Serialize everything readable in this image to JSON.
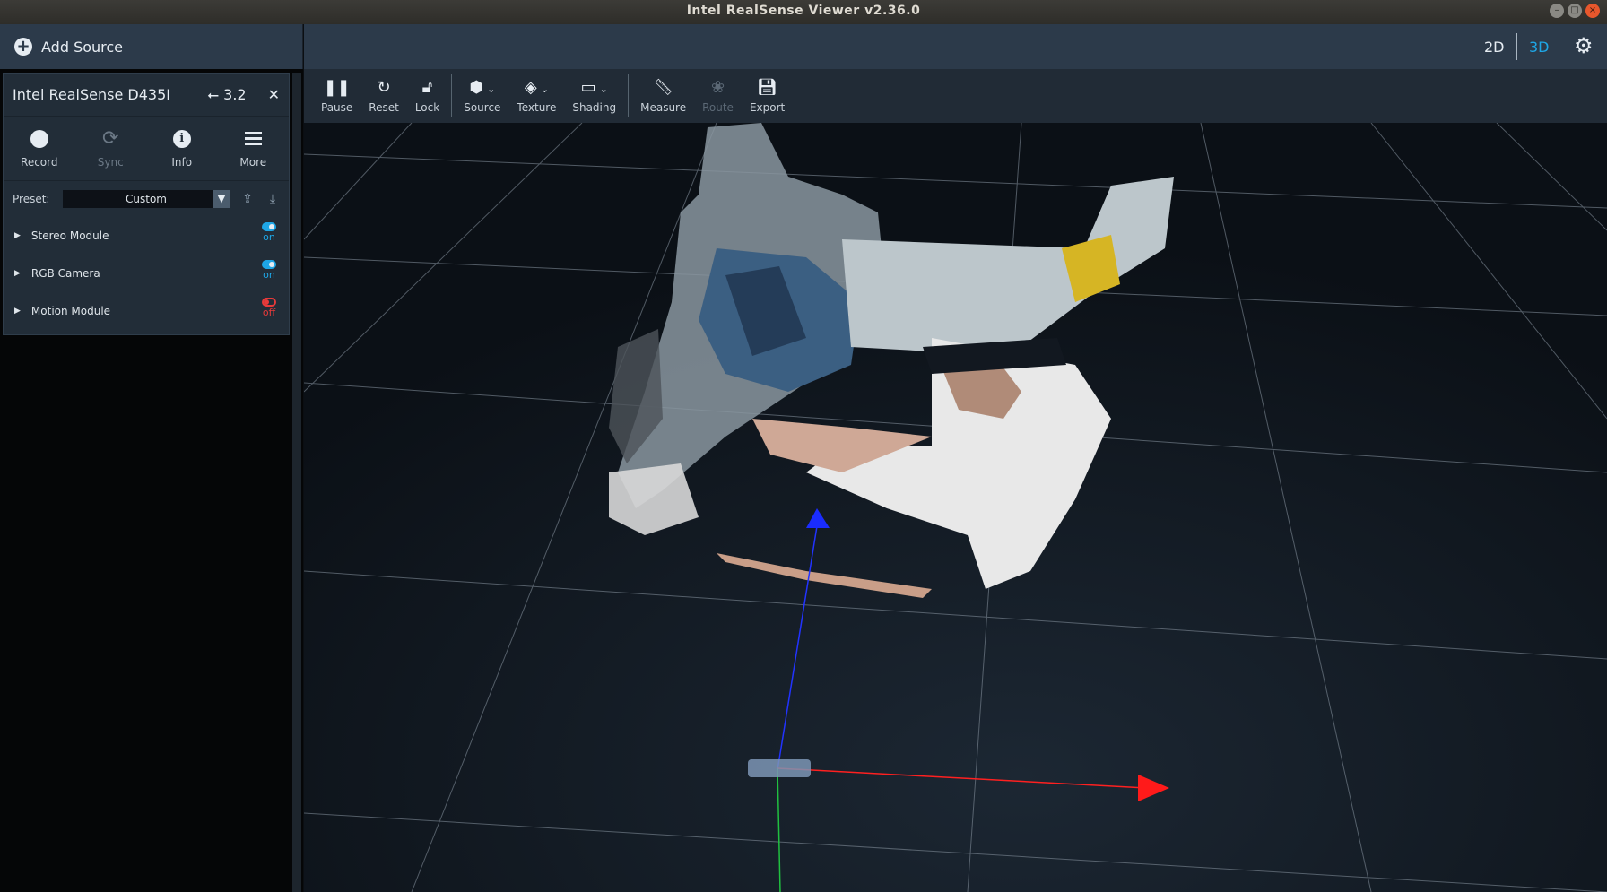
{
  "window": {
    "title": "Intel RealSense Viewer v2.36.0"
  },
  "sidebar": {
    "add_source_label": "Add Source",
    "device": {
      "name": "Intel RealSense D435I",
      "usb_version": "3.2",
      "actions": [
        {
          "label": "Record",
          "icon": "record-icon",
          "enabled": true
        },
        {
          "label": "Sync",
          "icon": "sync-icon",
          "enabled": false
        },
        {
          "label": "Info",
          "icon": "info-icon",
          "enabled": true
        },
        {
          "label": "More",
          "icon": "menu-icon",
          "enabled": true
        }
      ],
      "preset_label": "Preset:",
      "preset_value": "Custom",
      "modules": [
        {
          "name": "Stereo Module",
          "state": "on"
        },
        {
          "name": "RGB Camera",
          "state": "on"
        },
        {
          "name": "Motion Module",
          "state": "off"
        }
      ]
    }
  },
  "topbar": {
    "view_2d": "2D",
    "view_3d": "3D",
    "active_view": "3D"
  },
  "toolbar": {
    "buttons": [
      {
        "label": "Pause",
        "icon": "pause-icon",
        "enabled": true
      },
      {
        "label": "Reset",
        "icon": "reset-icon",
        "enabled": true
      },
      {
        "label": "Lock",
        "icon": "lock-icon",
        "enabled": true
      },
      {
        "label": "Source",
        "icon": "cube-icon",
        "enabled": true
      },
      {
        "label": "Texture",
        "icon": "paint-bucket-icon",
        "enabled": true
      },
      {
        "label": "Shading",
        "icon": "paint-roller-icon",
        "enabled": true
      },
      {
        "label": "Measure",
        "icon": "ruler-icon",
        "enabled": true
      },
      {
        "label": "Route",
        "icon": "paw-icon",
        "enabled": false
      },
      {
        "label": "Export",
        "icon": "save-icon",
        "enabled": true
      }
    ]
  },
  "colors": {
    "accent": "#1ea6e6",
    "off": "#e83a3a",
    "panel": "#222d38",
    "bar": "#2c3a4a"
  }
}
